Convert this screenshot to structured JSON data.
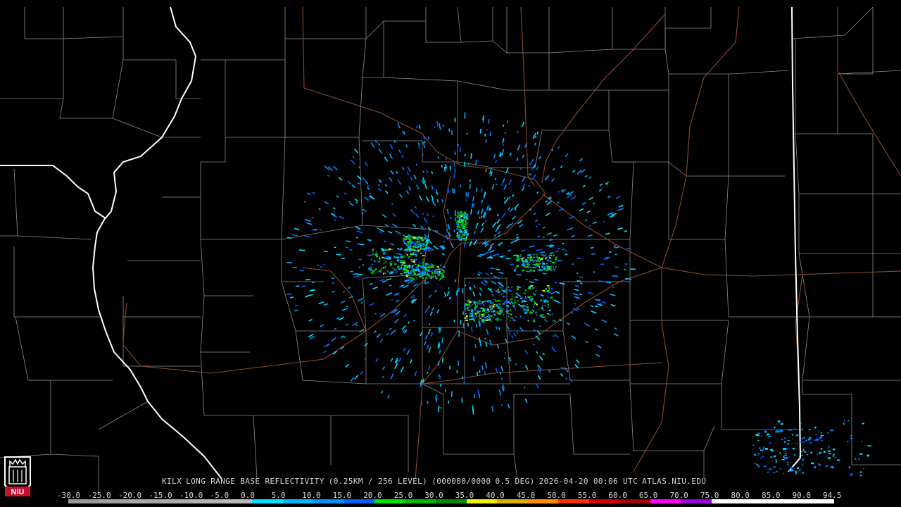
{
  "product_caption": {
    "station": "KILX",
    "product": "LONG RANGE BASE REFLECTIVITY",
    "resolution": "(0.25KM / 256 LEVEL)",
    "volume": "(000000/0000",
    "elevation": "0.5 DEG)",
    "datetime": "2026-04-20 00:06 UTC",
    "source": "ATLAS.NIU.EDU"
  },
  "logo": {
    "label": "NIU",
    "color": "#c8102e"
  },
  "color_scale": {
    "labels": [
      "-30.0",
      "-25.0",
      "-20.0",
      "-15.0",
      "-10.0",
      "-5.0",
      "0.0",
      "5.0",
      "10.0",
      "15.0",
      "20.0",
      "25.0",
      "30.0",
      "35.0",
      "40.0",
      "45.0",
      "50.0",
      "55.0",
      "60.0",
      "65.0",
      "70.0",
      "75.0",
      "80.0",
      "85.0",
      "90.0",
      "94.5"
    ],
    "colors": [
      "#9a9a9a",
      "#a0a0a0",
      "#a6a6a6",
      "#acacac",
      "#b2b2b2",
      "#b8b8b8",
      "#00e0ff",
      "#00b4ff",
      "#0090ff",
      "#0060ff",
      "#00e000",
      "#00b800",
      "#008800",
      "#f0f000",
      "#d8b000",
      "#ff9000",
      "#ff3000",
      "#d00000",
      "#a00000",
      "#ff00ff",
      "#a000e0",
      "#ffffff",
      "#ffffff",
      "#ffffff",
      "#ffffff"
    ]
  },
  "map_colors": {
    "background": "#000000",
    "county_lines": "#8a8a8a",
    "state_lines": "#ffffff",
    "highways": "#8b4a2c"
  }
}
